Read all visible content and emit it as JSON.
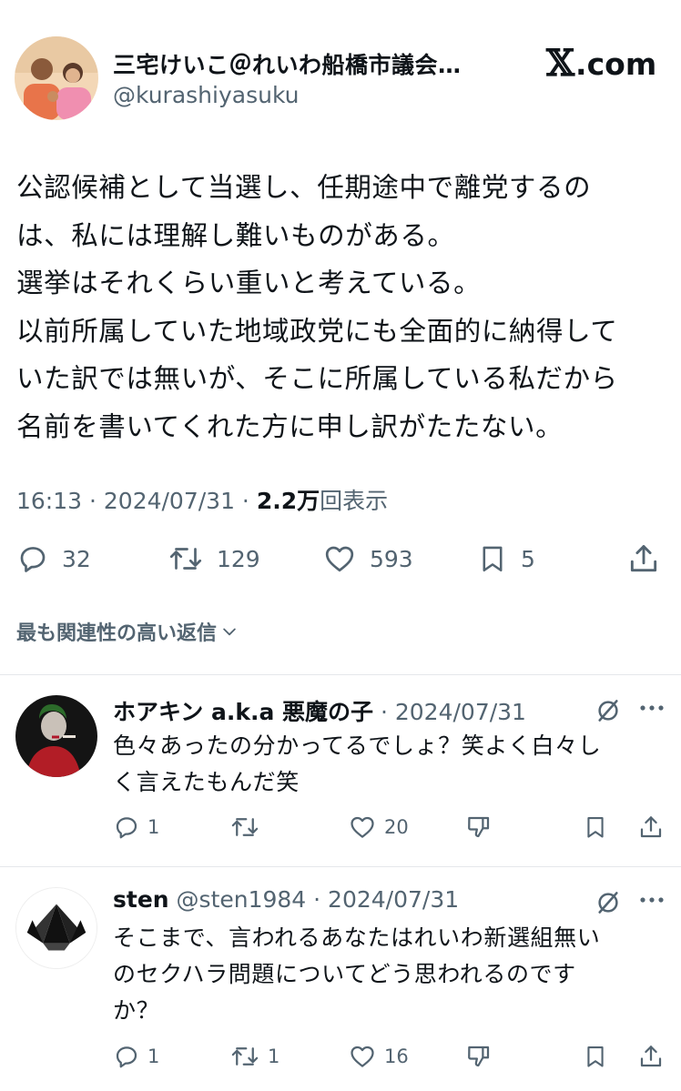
{
  "brand": {
    "x_glyph": "𝕏",
    "domain": ".com"
  },
  "tweet": {
    "author_name": "三宅けいこ＠れいわ船橋市議会…",
    "author_handle": "@kurashiyasuku",
    "text": "公認候補として当選し、任期途中で離党するの\nは、私には理解し難いものがある。\n選挙はそれくらい重いと考えている。\n以前所属していた地域政党にも全面的に納得して\nいた訳では無いが、そこに所属している私だから\n名前を書いてくれた方に申し訳がたたない。",
    "time": "16:13 · 2024/07/31 · ",
    "views_count": "2.2万",
    "views_label": "回表示",
    "replies": "32",
    "retweets": "129",
    "likes": "593",
    "bookmarks": "5"
  },
  "sort_label": "最も関連性の高い返信",
  "replies": [
    {
      "name": "ホアキン a.k.a 悪魔の子",
      "handle_date": " · 2024/07/31",
      "text": "色々あったの分かってるでしょ？笑よく白々し\nく言えたもんだ笑",
      "replies": "1",
      "retweets": "",
      "likes": "20"
    },
    {
      "name": "sten",
      "handle_date": " @sten1984 · 2024/07/31",
      "text": "そこまで、言われるあなたはれいわ新選組無い\nのセクハラ問題についてどう思われるのです\nか？",
      "replies": "1",
      "retweets": "1",
      "likes": "16"
    }
  ],
  "icons": [
    "reply-icon",
    "retweet-icon",
    "like-icon",
    "bookmark-icon",
    "share-icon",
    "grok-icon",
    "more-icon",
    "dislike-icon",
    "chevron-down-icon"
  ],
  "colors": {
    "text": "#0f1419",
    "secondary": "#536471",
    "divider": "#e5e7eb"
  }
}
